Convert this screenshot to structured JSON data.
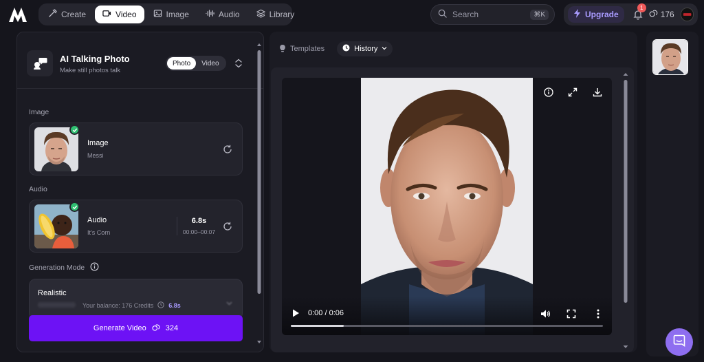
{
  "nav": {
    "items": [
      {
        "label": "Create",
        "icon": "create-icon"
      },
      {
        "label": "Video",
        "icon": "video-icon",
        "active": true
      },
      {
        "label": "Image",
        "icon": "image-icon"
      },
      {
        "label": "Audio",
        "icon": "audio-icon"
      },
      {
        "label": "Library",
        "icon": "library-icon"
      }
    ]
  },
  "search": {
    "placeholder": "Search",
    "shortcut": "⌘K"
  },
  "account": {
    "upgrade_label": "Upgrade",
    "notification_count": "1",
    "credits": "176"
  },
  "tool": {
    "title": "AI Talking Photo",
    "subtitle": "Make still photos talk",
    "modes": [
      "Photo",
      "Video"
    ],
    "active_mode": "Photo"
  },
  "image_section": {
    "label": "Image",
    "card_title": "Image",
    "card_sub": "Messi"
  },
  "audio_section": {
    "label": "Audio",
    "card_title": "Audio",
    "card_sub": "It's Corn",
    "duration": "6.8s",
    "range": "00:00–00:07"
  },
  "generation": {
    "label": "Generation Mode",
    "mode": "Realistic",
    "balance_text": "Your balance: 176 Credits",
    "seconds": "6.8s",
    "button_label": "Generate Video",
    "cost": "324"
  },
  "tabs": {
    "templates": "Templates",
    "history": "History"
  },
  "player": {
    "time": "0:00 / 0:06",
    "progress": 0.17
  },
  "colors": {
    "accent": "#6d12f5",
    "upgrade": "#a99bff",
    "success": "#2fbf71",
    "badge": "#f05a5a",
    "chat": "#8e6ef0"
  }
}
